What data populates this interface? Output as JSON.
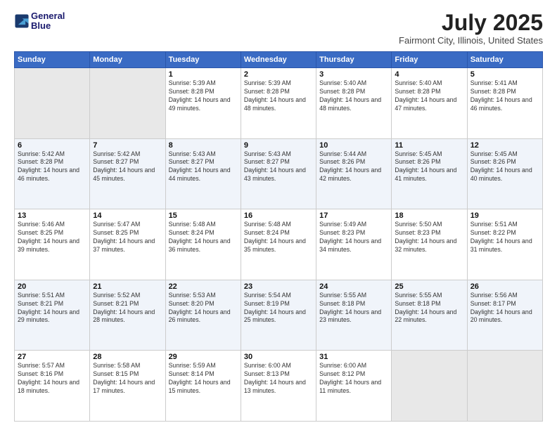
{
  "logo": {
    "line1": "General",
    "line2": "Blue"
  },
  "title": "July 2025",
  "subtitle": "Fairmont City, Illinois, United States",
  "weekdays": [
    "Sunday",
    "Monday",
    "Tuesday",
    "Wednesday",
    "Thursday",
    "Friday",
    "Saturday"
  ],
  "weeks": [
    [
      {
        "day": "",
        "detail": ""
      },
      {
        "day": "",
        "detail": ""
      },
      {
        "day": "1",
        "detail": "Sunrise: 5:39 AM\nSunset: 8:28 PM\nDaylight: 14 hours and 49 minutes."
      },
      {
        "day": "2",
        "detail": "Sunrise: 5:39 AM\nSunset: 8:28 PM\nDaylight: 14 hours and 48 minutes."
      },
      {
        "day": "3",
        "detail": "Sunrise: 5:40 AM\nSunset: 8:28 PM\nDaylight: 14 hours and 48 minutes."
      },
      {
        "day": "4",
        "detail": "Sunrise: 5:40 AM\nSunset: 8:28 PM\nDaylight: 14 hours and 47 minutes."
      },
      {
        "day": "5",
        "detail": "Sunrise: 5:41 AM\nSunset: 8:28 PM\nDaylight: 14 hours and 46 minutes."
      }
    ],
    [
      {
        "day": "6",
        "detail": "Sunrise: 5:42 AM\nSunset: 8:28 PM\nDaylight: 14 hours and 46 minutes."
      },
      {
        "day": "7",
        "detail": "Sunrise: 5:42 AM\nSunset: 8:27 PM\nDaylight: 14 hours and 45 minutes."
      },
      {
        "day": "8",
        "detail": "Sunrise: 5:43 AM\nSunset: 8:27 PM\nDaylight: 14 hours and 44 minutes."
      },
      {
        "day": "9",
        "detail": "Sunrise: 5:43 AM\nSunset: 8:27 PM\nDaylight: 14 hours and 43 minutes."
      },
      {
        "day": "10",
        "detail": "Sunrise: 5:44 AM\nSunset: 8:26 PM\nDaylight: 14 hours and 42 minutes."
      },
      {
        "day": "11",
        "detail": "Sunrise: 5:45 AM\nSunset: 8:26 PM\nDaylight: 14 hours and 41 minutes."
      },
      {
        "day": "12",
        "detail": "Sunrise: 5:45 AM\nSunset: 8:26 PM\nDaylight: 14 hours and 40 minutes."
      }
    ],
    [
      {
        "day": "13",
        "detail": "Sunrise: 5:46 AM\nSunset: 8:25 PM\nDaylight: 14 hours and 39 minutes."
      },
      {
        "day": "14",
        "detail": "Sunrise: 5:47 AM\nSunset: 8:25 PM\nDaylight: 14 hours and 37 minutes."
      },
      {
        "day": "15",
        "detail": "Sunrise: 5:48 AM\nSunset: 8:24 PM\nDaylight: 14 hours and 36 minutes."
      },
      {
        "day": "16",
        "detail": "Sunrise: 5:48 AM\nSunset: 8:24 PM\nDaylight: 14 hours and 35 minutes."
      },
      {
        "day": "17",
        "detail": "Sunrise: 5:49 AM\nSunset: 8:23 PM\nDaylight: 14 hours and 34 minutes."
      },
      {
        "day": "18",
        "detail": "Sunrise: 5:50 AM\nSunset: 8:23 PM\nDaylight: 14 hours and 32 minutes."
      },
      {
        "day": "19",
        "detail": "Sunrise: 5:51 AM\nSunset: 8:22 PM\nDaylight: 14 hours and 31 minutes."
      }
    ],
    [
      {
        "day": "20",
        "detail": "Sunrise: 5:51 AM\nSunset: 8:21 PM\nDaylight: 14 hours and 29 minutes."
      },
      {
        "day": "21",
        "detail": "Sunrise: 5:52 AM\nSunset: 8:21 PM\nDaylight: 14 hours and 28 minutes."
      },
      {
        "day": "22",
        "detail": "Sunrise: 5:53 AM\nSunset: 8:20 PM\nDaylight: 14 hours and 26 minutes."
      },
      {
        "day": "23",
        "detail": "Sunrise: 5:54 AM\nSunset: 8:19 PM\nDaylight: 14 hours and 25 minutes."
      },
      {
        "day": "24",
        "detail": "Sunrise: 5:55 AM\nSunset: 8:18 PM\nDaylight: 14 hours and 23 minutes."
      },
      {
        "day": "25",
        "detail": "Sunrise: 5:55 AM\nSunset: 8:18 PM\nDaylight: 14 hours and 22 minutes."
      },
      {
        "day": "26",
        "detail": "Sunrise: 5:56 AM\nSunset: 8:17 PM\nDaylight: 14 hours and 20 minutes."
      }
    ],
    [
      {
        "day": "27",
        "detail": "Sunrise: 5:57 AM\nSunset: 8:16 PM\nDaylight: 14 hours and 18 minutes."
      },
      {
        "day": "28",
        "detail": "Sunrise: 5:58 AM\nSunset: 8:15 PM\nDaylight: 14 hours and 17 minutes."
      },
      {
        "day": "29",
        "detail": "Sunrise: 5:59 AM\nSunset: 8:14 PM\nDaylight: 14 hours and 15 minutes."
      },
      {
        "day": "30",
        "detail": "Sunrise: 6:00 AM\nSunset: 8:13 PM\nDaylight: 14 hours and 13 minutes."
      },
      {
        "day": "31",
        "detail": "Sunrise: 6:00 AM\nSunset: 8:12 PM\nDaylight: 14 hours and 11 minutes."
      },
      {
        "day": "",
        "detail": ""
      },
      {
        "day": "",
        "detail": ""
      }
    ]
  ]
}
